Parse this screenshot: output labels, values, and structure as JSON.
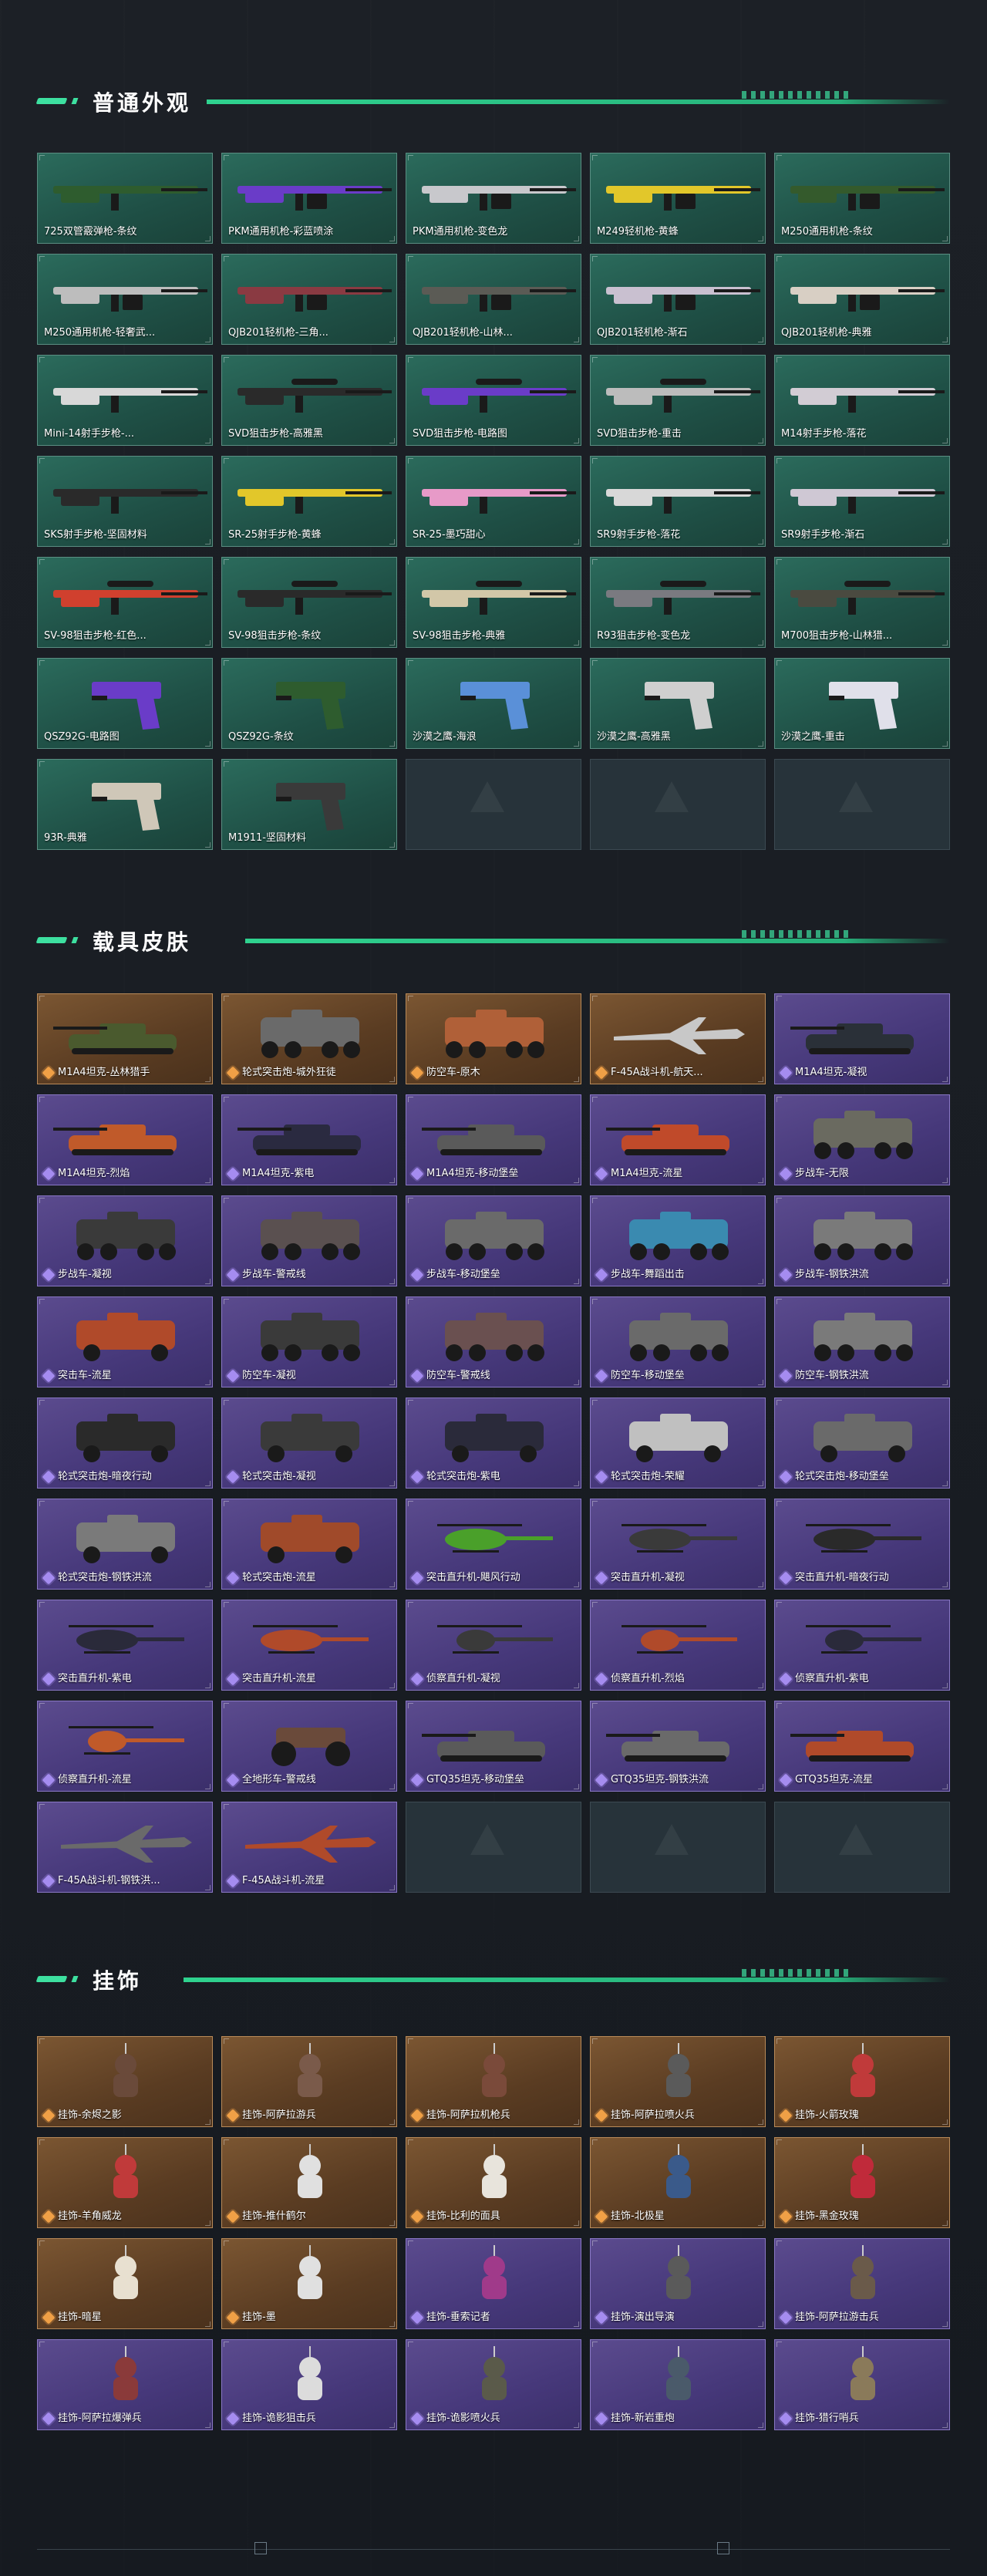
{
  "sections": {
    "weapons": {
      "title": "普通外观"
    },
    "vehicles": {
      "title": "载具皮肤"
    },
    "charms": {
      "title": "挂饰"
    }
  },
  "colors": {
    "accent": "#3de0a0",
    "green_card": "#24594d",
    "orange_card": "#6a4829",
    "purple_card": "#4b3d80"
  },
  "weapons": [
    {
      "label": "725双管霰弹枪-条纹",
      "kind": "shotgun",
      "art": "#2e5c2e"
    },
    {
      "label": "PKM通用机枪-彩蓝喷涂",
      "kind": "mg",
      "art": "#6a3cc8"
    },
    {
      "label": "PKM通用机枪-变色龙",
      "kind": "mg",
      "art": "#c8c8cc"
    },
    {
      "label": "M249轻机枪-黄蜂",
      "kind": "mg",
      "art": "#e2c72a"
    },
    {
      "label": "M250通用机枪-条纹",
      "kind": "mg",
      "art": "#345a2c"
    },
    {
      "label": "M250通用机枪-轻奢武...",
      "kind": "mg",
      "art": "#bdbdbd"
    },
    {
      "label": "QJB201轻机枪-三角...",
      "kind": "mg",
      "art": "#8a3a42"
    },
    {
      "label": "QJB201轻机枪-山林...",
      "kind": "mg",
      "art": "#5b5b55"
    },
    {
      "label": "QJB201轻机枪-渐石",
      "kind": "mg",
      "art": "#c9c0d0"
    },
    {
      "label": "QJB201轻机枪-典雅",
      "kind": "mg",
      "art": "#d8cfc4"
    },
    {
      "label": "Mini-14射手步枪-...",
      "kind": "rifle",
      "art": "#d8d8d8"
    },
    {
      "label": "SVD狙击步枪-高雅黑",
      "kind": "sniper",
      "art": "#2a2a2a"
    },
    {
      "label": "SVD狙击步枪-电路图",
      "kind": "sniper",
      "art": "#6a3cc8"
    },
    {
      "label": "SVD狙击步枪-重击",
      "kind": "sniper",
      "art": "#bcbcbc"
    },
    {
      "label": "M14射手步枪-落花",
      "kind": "rifle",
      "art": "#d2ccd4"
    },
    {
      "label": "SKS射手步枪-坚固材料",
      "kind": "rifle",
      "art": "#2a2a2a"
    },
    {
      "label": "SR-25射手步枪-黄蜂",
      "kind": "rifle",
      "art": "#e2c72a"
    },
    {
      "label": "SR-25-墨巧甜心",
      "kind": "rifle",
      "art": "#e79ac8"
    },
    {
      "label": "SR9射手步枪-落花",
      "kind": "rifle",
      "art": "#d8d8d8"
    },
    {
      "label": "SR9射手步枪-渐石",
      "kind": "rifle",
      "art": "#cfc8d4"
    },
    {
      "label": "SV-98狙击步枪-红色...",
      "kind": "sniper",
      "art": "#d0402e"
    },
    {
      "label": "SV-98狙击步枪-条纹",
      "kind": "sniper",
      "art": "#2a2a2a"
    },
    {
      "label": "SV-98狙击步枪-典雅",
      "kind": "sniper",
      "art": "#d2c7a8"
    },
    {
      "label": "R93狙击步枪-变色龙",
      "kind": "sniper",
      "art": "#7a7a80"
    },
    {
      "label": "M700狙击步枪-山林猎...",
      "kind": "sniper",
      "art": "#4a4a40"
    },
    {
      "label": "QSZ92G-电路图",
      "kind": "pistol",
      "art": "#6a3cc8"
    },
    {
      "label": "QSZ92G-条纹",
      "kind": "pistol",
      "art": "#2e5c2e"
    },
    {
      "label": "沙漠之鹰-海浪",
      "kind": "pistol",
      "art": "#5a90d8"
    },
    {
      "label": "沙漠之鹰-高雅黑",
      "kind": "pistol",
      "art": "#cfcfcf"
    },
    {
      "label": "沙漠之鹰-重击",
      "kind": "pistol",
      "art": "#e0e0ea"
    },
    {
      "label": "93R-典雅",
      "kind": "pistol",
      "art": "#cfc7b8"
    },
    {
      "label": "M1911-坚固材料",
      "kind": "pistol",
      "art": "#3a3a3a"
    }
  ],
  "vehicles": [
    {
      "label": "M1A4坦克-丛林猎手",
      "rarity": "orange",
      "kind": "tank",
      "art": "#4a5a2e"
    },
    {
      "label": "轮式突击炮-城外狂徒",
      "rarity": "orange",
      "kind": "apc",
      "art": "#6a6a6a"
    },
    {
      "label": "防空车-原木",
      "rarity": "orange",
      "kind": "apc",
      "art": "#b06038"
    },
    {
      "label": "F-45A战斗机-航天...",
      "rarity": "orange",
      "kind": "jet",
      "art": "#c8c8c8"
    },
    {
      "label": "M1A4坦克-凝视",
      "rarity": "purple",
      "kind": "tank",
      "art": "#2a3038"
    },
    {
      "label": "M1A4坦克-烈焰",
      "rarity": "purple",
      "kind": "tank",
      "art": "#c05a2a"
    },
    {
      "label": "M1A4坦克-紫电",
      "rarity": "purple",
      "kind": "tank",
      "art": "#2a2a40"
    },
    {
      "label": "M1A4坦克-移动堡垒",
      "rarity": "purple",
      "kind": "tank",
      "art": "#5a5a5a"
    },
    {
      "label": "M1A4坦克-流星",
      "rarity": "purple",
      "kind": "tank",
      "art": "#c04a2a"
    },
    {
      "label": "步战车-无限",
      "rarity": "purple",
      "kind": "apc",
      "art": "#6a6a60"
    },
    {
      "label": "步战车-凝视",
      "rarity": "purple",
      "kind": "apc",
      "art": "#3a3a3a"
    },
    {
      "label": "步战车-警戒线",
      "rarity": "purple",
      "kind": "apc",
      "art": "#5a5050"
    },
    {
      "label": "步战车-移动堡垒",
      "rarity": "purple",
      "kind": "apc",
      "art": "#6a6a6a"
    },
    {
      "label": "步战车-舞蹈出击",
      "rarity": "purple",
      "kind": "apc",
      "art": "#3a8ab0"
    },
    {
      "label": "步战车-钢铁洪流",
      "rarity": "purple",
      "kind": "apc",
      "art": "#7a7a7a"
    },
    {
      "label": "突击车-流星",
      "rarity": "purple",
      "kind": "truck",
      "art": "#b04a2a"
    },
    {
      "label": "防空车-凝视",
      "rarity": "purple",
      "kind": "apc",
      "art": "#3a3a3a"
    },
    {
      "label": "防空车-警戒线",
      "rarity": "purple",
      "kind": "apc",
      "art": "#6a5050"
    },
    {
      "label": "防空车-移动堡垒",
      "rarity": "purple",
      "kind": "apc",
      "art": "#6a6a6a"
    },
    {
      "label": "防空车-钢铁洪流",
      "rarity": "purple",
      "kind": "apc",
      "art": "#7a7a7a"
    },
    {
      "label": "轮式突击炮-暗夜行动",
      "rarity": "purple",
      "kind": "truck",
      "art": "#2a2a2a"
    },
    {
      "label": "轮式突击炮-凝视",
      "rarity": "purple",
      "kind": "truck",
      "art": "#3a3a3a"
    },
    {
      "label": "轮式突击炮-紫电",
      "rarity": "purple",
      "kind": "truck",
      "art": "#2a2a3a"
    },
    {
      "label": "轮式突击炮-荣耀",
      "rarity": "purple",
      "kind": "truck",
      "art": "#c0c0c0"
    },
    {
      "label": "轮式突击炮-移动堡垒",
      "rarity": "purple",
      "kind": "truck",
      "art": "#6a6a6a"
    },
    {
      "label": "轮式突击炮-钢铁洪流",
      "rarity": "purple",
      "kind": "truck",
      "art": "#7a7a7a"
    },
    {
      "label": "轮式突击炮-流星",
      "rarity": "purple",
      "kind": "truck",
      "art": "#a04a2a"
    },
    {
      "label": "突击直升机-飓风行动",
      "rarity": "purple",
      "kind": "heli",
      "art": "#4aa02a"
    },
    {
      "label": "突击直升机-凝视",
      "rarity": "purple",
      "kind": "heli",
      "art": "#3a3a3a"
    },
    {
      "label": "突击直升机-暗夜行动",
      "rarity": "purple",
      "kind": "heli",
      "art": "#2a2a2a"
    },
    {
      "label": "突击直升机-紫电",
      "rarity": "purple",
      "kind": "heli",
      "art": "#2a2a3a"
    },
    {
      "label": "突击直升机-流星",
      "rarity": "purple",
      "kind": "heli",
      "art": "#b04a2a"
    },
    {
      "label": "侦察直升机-凝视",
      "rarity": "purple",
      "kind": "smallheli",
      "art": "#3a3a3a"
    },
    {
      "label": "侦察直升机-烈焰",
      "rarity": "purple",
      "kind": "smallheli",
      "art": "#b04a2a"
    },
    {
      "label": "侦察直升机-紫电",
      "rarity": "purple",
      "kind": "smallheli",
      "art": "#2a2a3a"
    },
    {
      "label": "侦察直升机-流星",
      "rarity": "purple",
      "kind": "smallheli",
      "art": "#c05a2a"
    },
    {
      "label": "全地形车-警戒线",
      "rarity": "purple",
      "kind": "atv",
      "art": "#6a4a3a"
    },
    {
      "label": "GTQ35坦克-移动堡垒",
      "rarity": "purple",
      "kind": "tank",
      "art": "#5a5a5a"
    },
    {
      "label": "GTQ35坦克-钢铁洪流",
      "rarity": "purple",
      "kind": "tank",
      "art": "#6a6a6a"
    },
    {
      "label": "GTQ35坦克-流星",
      "rarity": "purple",
      "kind": "tank",
      "art": "#b04a2a"
    },
    {
      "label": "F-45A战斗机-钢铁洪...",
      "rarity": "purple",
      "kind": "jet",
      "art": "#6a6a6a"
    },
    {
      "label": "F-45A战斗机-流星",
      "rarity": "purple",
      "kind": "jet",
      "art": "#b04a2a"
    }
  ],
  "charms": [
    {
      "label": "挂饰-余烬之影",
      "rarity": "orange",
      "art": "#6a4a3a"
    },
    {
      "label": "挂饰-阿萨拉游兵",
      "rarity": "orange",
      "art": "#7a5a4a"
    },
    {
      "label": "挂饰-阿萨拉机枪兵",
      "rarity": "orange",
      "art": "#7a4a3a"
    },
    {
      "label": "挂饰-阿萨拉喷火兵",
      "rarity": "orange",
      "art": "#5a5a5a"
    },
    {
      "label": "挂饰-火箭玫瑰",
      "rarity": "orange",
      "art": "#c03a3a"
    },
    {
      "label": "挂饰-羊角威龙",
      "rarity": "orange",
      "art": "#c03a3a"
    },
    {
      "label": "挂饰-推什鹤尔",
      "rarity": "orange",
      "art": "#e0e0e0"
    },
    {
      "label": "挂饰-比利的面具",
      "rarity": "orange",
      "art": "#e8e4dc"
    },
    {
      "label": "挂饰-北极星",
      "rarity": "orange",
      "art": "#3a5a8a"
    },
    {
      "label": "挂饰-黑金玫瑰",
      "rarity": "orange",
      "art": "#c02a3a"
    },
    {
      "label": "挂饰-暗星",
      "rarity": "orange",
      "art": "#e8e0d0"
    },
    {
      "label": "挂饰-墨",
      "rarity": "orange",
      "art": "#e0e0e0"
    },
    {
      "label": "挂饰-垂索记者",
      "rarity": "purple",
      "art": "#a03a8a"
    },
    {
      "label": "挂饰-演出导演",
      "rarity": "purple",
      "art": "#5a5a5a"
    },
    {
      "label": "挂饰-阿萨拉游击兵",
      "rarity": "purple",
      "art": "#6a5a4a"
    },
    {
      "label": "挂饰-阿萨拉爆弹兵",
      "rarity": "purple",
      "art": "#8a3a3a"
    },
    {
      "label": "挂饰-诡影狙击兵",
      "rarity": "purple",
      "art": "#dcdcdc"
    },
    {
      "label": "挂饰-诡影喷火兵",
      "rarity": "purple",
      "art": "#5a5a4a"
    },
    {
      "label": "挂饰-新岩重炮",
      "rarity": "purple",
      "art": "#4a5a6a"
    },
    {
      "label": "挂饰-猎行哨兵",
      "rarity": "purple",
      "art": "#8a7a5a"
    }
  ]
}
